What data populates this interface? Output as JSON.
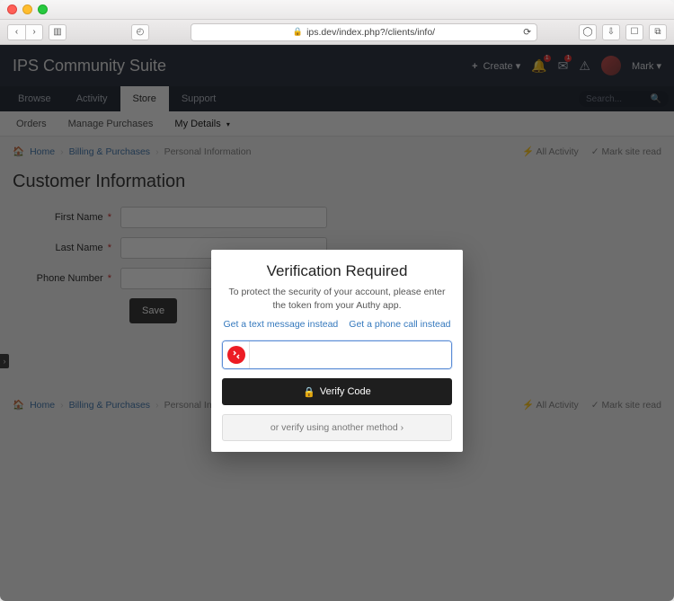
{
  "browser": {
    "url": "ips.dev/index.php?/clients/info/"
  },
  "app": {
    "title": "IPS Community Suite",
    "create_label": "Create",
    "user_name": "Mark",
    "search_placeholder": "Search...",
    "notif_badge": "1",
    "msg_badge": "1"
  },
  "nav1": {
    "items": [
      {
        "label": "Browse"
      },
      {
        "label": "Activity"
      },
      {
        "label": "Store"
      },
      {
        "label": "Support"
      }
    ]
  },
  "nav2": {
    "items": [
      {
        "label": "Orders"
      },
      {
        "label": "Manage Purchases"
      },
      {
        "label": "My Details"
      }
    ]
  },
  "crumbs": {
    "home": "Home",
    "section": "Billing & Purchases",
    "current": "Personal Information",
    "all_activity": "All Activity",
    "mark_read": "Mark site read"
  },
  "page": {
    "title": "Customer Information",
    "first_name_label": "First Name",
    "last_name_label": "Last Name",
    "phone_label": "Phone Number",
    "required": "*",
    "save": "Save"
  },
  "modal": {
    "title": "Verification Required",
    "desc": "To protect the security of your account, please enter the token from your Authy app.",
    "text_link": "Get a text message instead",
    "call_link": "Get a phone call instead",
    "verify": "Verify Code",
    "alt": "or verify using another method ›"
  }
}
